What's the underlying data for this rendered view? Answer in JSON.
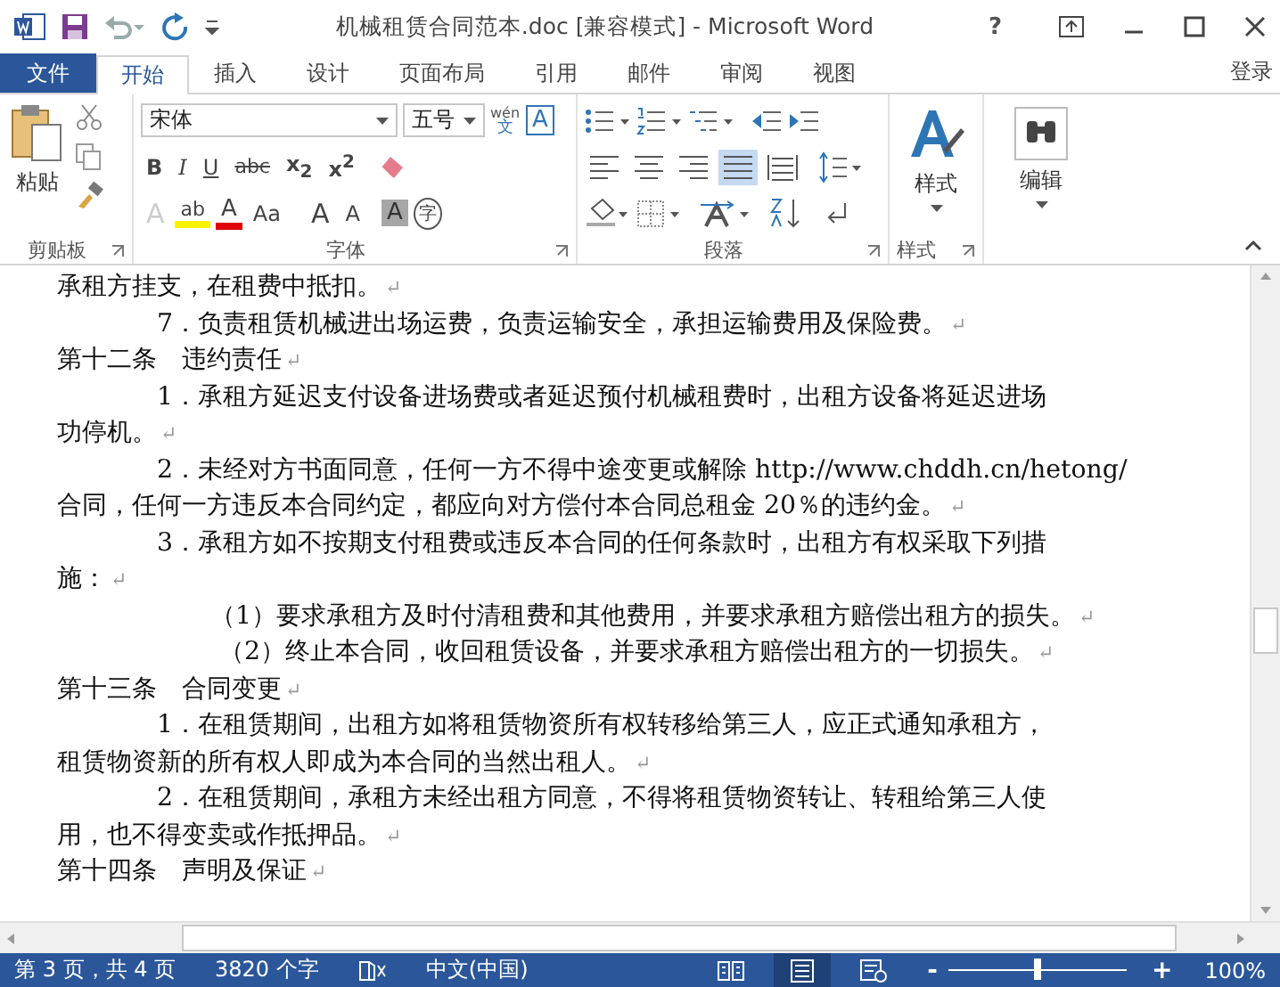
{
  "title_bar": {
    "title": "机械租赁合同范本.doc [兼容模式] - Microsoft Word",
    "help": "?"
  },
  "tabs": [
    {
      "label": "文件",
      "kind": "file",
      "selected": false
    },
    {
      "label": "开始",
      "kind": "tab",
      "selected": true
    },
    {
      "label": "插入",
      "kind": "tab",
      "selected": false
    },
    {
      "label": "设计",
      "kind": "tab",
      "selected": false
    },
    {
      "label": "页面布局",
      "kind": "tab",
      "selected": false
    },
    {
      "label": "引用",
      "kind": "tab",
      "selected": false
    },
    {
      "label": "邮件",
      "kind": "tab",
      "selected": false
    },
    {
      "label": "审阅",
      "kind": "tab",
      "selected": false
    },
    {
      "label": "视图",
      "kind": "tab",
      "selected": false
    }
  ],
  "sign_in": "登录",
  "clipboard": {
    "paste": "粘贴",
    "label": "剪贴板"
  },
  "font": {
    "name": "宋体",
    "size": "五号",
    "phonetic_top": "wén",
    "phonetic_bottom": "文",
    "border_char": "A",
    "format_buttons": [
      "B",
      "I",
      "U",
      "abc",
      "x$_{2}$",
      "x$^{2}$"
    ],
    "effects": [
      {
        "kind": "effect",
        "label": "A"
      },
      {
        "kind": "highlight",
        "label": "ab"
      },
      {
        "kind": "color",
        "label": "A"
      },
      {
        "kind": "case",
        "label": "Aa"
      }
    ],
    "sizing": [
      {
        "kind": "grow",
        "label": "A"
      },
      {
        "kind": "shrink",
        "label": "A"
      },
      {
        "kind": "shade",
        "label": "A"
      },
      {
        "kind": "enclose",
        "label": "字"
      }
    ],
    "label": "字体"
  },
  "paragraph": {
    "label": "段落",
    "align": [
      {
        "kind": "left",
        "selected": false
      },
      {
        "kind": "center",
        "selected": false
      },
      {
        "kind": "right",
        "selected": false
      },
      {
        "kind": "justify",
        "selected": true
      },
      {
        "kind": "distribute",
        "selected": false
      }
    ]
  },
  "styles": {
    "button": "样式",
    "label": "样式"
  },
  "editing": {
    "button": "编辑"
  },
  "document": {
    "lines": [
      {
        "kind": "plain",
        "text": "承租方挂支，在租费中抵扣。",
        "mark": "↵"
      },
      {
        "kind": "indent",
        "text": "7．负责租赁机械进出场运费，负责运输安全，承担运输费用及保险费。",
        "mark": "↵"
      },
      {
        "kind": "plain",
        "text": "第十二条　违约责任",
        "mark": "↵"
      },
      {
        "kind": "indent",
        "text": "1．承租方延迟支付设备进场费或者延迟预付机械租费时，出租方设备将延迟进场"
      },
      {
        "kind": "plain",
        "text": "功停机。",
        "mark": "↵"
      },
      {
        "kind": "indent",
        "text": "2．未经对方书面同意，任何一方不得中途变更或解除 http://www.chddh.cn/hetong/"
      },
      {
        "kind": "plain",
        "text": "合同，任何一方违反本合同约定，都应向对方偿付本合同总租金 20％的违约金。",
        "mark": "↵"
      },
      {
        "kind": "indent",
        "text": "3．承租方如不按期支付租费或违反本合同的任何条款时，出租方有权采取下列措"
      },
      {
        "kind": "plain",
        "text": "施：",
        "mark": "↵"
      },
      {
        "kind": "sub",
        "text": "（1）要求承租方及时付清租费和其他费用，并要求承租方赔偿出租方的损失。",
        "mark": "↵"
      },
      {
        "kind": "sub2",
        "text": "（2）终止本合同，收回租赁设备，并要求承租方赔偿出租方的一切损失。",
        "mark": "↵"
      },
      {
        "kind": "plain",
        "text": "第十三条　合同变更",
        "mark": "↵"
      },
      {
        "kind": "indent",
        "text": "1．在租赁期间，出租方如将租赁物资所有权转移给第三人，应正式通知承租方，"
      },
      {
        "kind": "plain",
        "text": "租赁物资新的所有权人即成为本合同的当然出租人。",
        "mark": "↵"
      },
      {
        "kind": "indent",
        "text": "2．在租赁期间，承租方未经出租方同意，不得将租赁物资转让、转租给第三人使"
      },
      {
        "kind": "plain",
        "text": "用，也不得变卖或作抵押品。",
        "mark": "↵"
      },
      {
        "kind": "plain",
        "text": "第十四条　声明及保证",
        "mark": "↵"
      }
    ]
  },
  "status": {
    "page": "第 3 页，共 4 页",
    "words": "3820 个字",
    "language": "中文(中国)",
    "zoom_out": "-",
    "zoom_in": "+",
    "zoom": "100%",
    "zoom_slider": {
      "level": 0.5
    },
    "views": [
      {
        "kind": "read",
        "selected": false
      },
      {
        "kind": "print",
        "selected": true
      },
      {
        "kind": "web",
        "selected": false
      }
    ]
  }
}
